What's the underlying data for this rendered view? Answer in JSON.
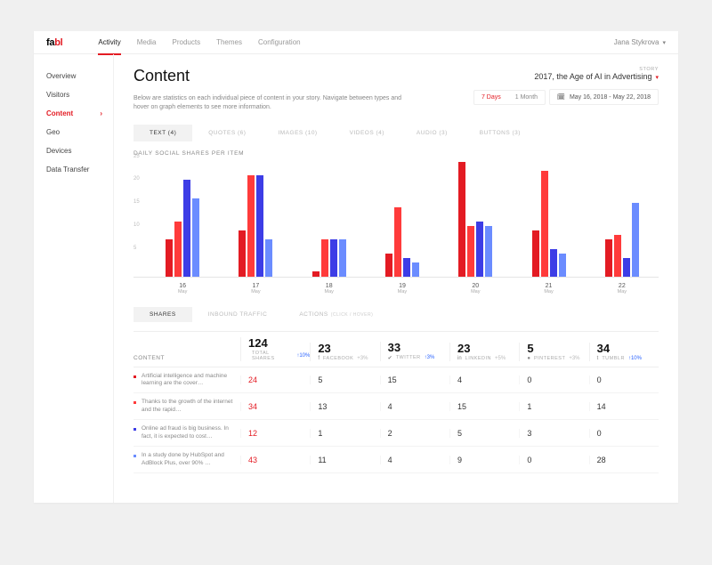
{
  "logo": {
    "a": "fa",
    "b": "bl"
  },
  "topnav": [
    "Activity",
    "Media",
    "Products",
    "Themes",
    "Configuration"
  ],
  "topnav_active": 0,
  "user": "Jana Stykrova",
  "sidebar": [
    "Overview",
    "Visitors",
    "Content",
    "Geo",
    "Devices",
    "Data Transfer"
  ],
  "sidebar_active": 2,
  "page": {
    "title": "Content",
    "desc": "Below are statistics on each individual piece of content in your story. Navigate between types and hover on graph elements to see more information."
  },
  "story": {
    "label": "STORY",
    "title": "2017, the Age of AI in Advertising"
  },
  "range": {
    "opts": [
      "7 Days",
      "1 Month"
    ],
    "active": 0,
    "date": "May 16, 2018 - May 22, 2018"
  },
  "content_tabs": [
    {
      "l": "TEXT",
      "c": 4
    },
    {
      "l": "QUOTES",
      "c": 6
    },
    {
      "l": "IMAGES",
      "c": 10
    },
    {
      "l": "VIDEOS",
      "c": 4
    },
    {
      "l": "AUDIO",
      "c": 3
    },
    {
      "l": "BUTTONS",
      "c": 3
    }
  ],
  "content_tab_active": 0,
  "chart_data": {
    "type": "bar",
    "title": "DAILY SOCIAL SHARES PER ITEM",
    "ylabel": "",
    "xlabel": "",
    "ylim": [
      0,
      25
    ],
    "yticks": [
      5,
      10,
      15,
      20,
      25
    ],
    "categories": [
      "16",
      "17",
      "18",
      "19",
      "20",
      "21",
      "22"
    ],
    "x_sublabel": "May",
    "series_colors": [
      "#e31b23",
      "#ff3b3b",
      "#3d3de6",
      "#6b8cff"
    ],
    "data": [
      [
        8,
        12,
        21,
        17
      ],
      [
        10,
        22,
        22,
        8
      ],
      [
        1,
        8,
        8,
        8
      ],
      [
        5,
        15,
        4,
        3
      ],
      [
        25,
        11,
        12,
        11
      ],
      [
        10,
        23,
        6,
        5
      ],
      [
        8,
        9,
        4,
        16
      ]
    ]
  },
  "metric_tabs": [
    {
      "l": "SHARES"
    },
    {
      "l": "INBOUND TRAFFIC"
    },
    {
      "l": "ACTIONS",
      "sub": "(CLICK / HOVER)"
    }
  ],
  "metric_tab_active": 0,
  "columns": [
    {
      "val": "124",
      "icon": "",
      "label": "TOTAL SHARES",
      "delta": "↑10%",
      "dclass": "delta-up"
    },
    {
      "val": "23",
      "icon": "f",
      "label": "FACEBOOK",
      "delta": "+3%",
      "dclass": "delta-neutral"
    },
    {
      "val": "33",
      "icon": "✔",
      "label": "TWITTER",
      "delta": "↑3%",
      "dclass": "delta-up"
    },
    {
      "val": "23",
      "icon": "in",
      "label": "LINKEDIN",
      "delta": "+5%",
      "dclass": "delta-neutral"
    },
    {
      "val": "5",
      "icon": "●",
      "label": "PINTEREST",
      "delta": "+3%",
      "dclass": "delta-neutral"
    },
    {
      "val": "34",
      "icon": "t",
      "label": "TUMBLR",
      "delta": "↑10%",
      "dclass": "delta-up"
    }
  ],
  "rows": [
    {
      "dot": "#e31b23",
      "text": "Artificial intelligence and machine learning are the cover…",
      "vals": [
        "24",
        "5",
        "15",
        "4",
        "0",
        "0"
      ]
    },
    {
      "dot": "#ff3b3b",
      "text": "Thanks to the growth of the internet and the rapid…",
      "vals": [
        "34",
        "13",
        "4",
        "15",
        "1",
        "14"
      ]
    },
    {
      "dot": "#3d3de6",
      "text": "Online ad fraud is big business. In fact, it is expected to cost…",
      "vals": [
        "12",
        "1",
        "2",
        "5",
        "3",
        "0"
      ]
    },
    {
      "dot": "#6b8cff",
      "text": "In a study done by HubSpot and AdBlock Plus, over 90% …",
      "vals": [
        "43",
        "11",
        "4",
        "9",
        "0",
        "28"
      ]
    }
  ],
  "labels": {
    "content": "CONTENT"
  }
}
